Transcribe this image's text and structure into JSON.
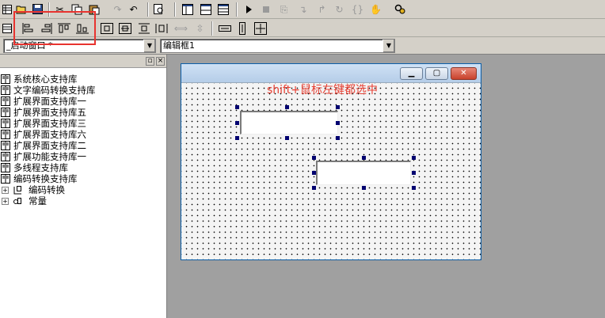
{
  "toolbar_main": {
    "icons": [
      "grid-icon",
      "open-icon",
      "save-icon",
      "cut-icon",
      "copy-icon",
      "paste-icon",
      "redo-icon",
      "undo-icon",
      "find-icon",
      "layout-one-icon",
      "layout-two-icon",
      "layout-three-icon",
      "run-icon",
      "stop-icon",
      "step-icon",
      "step-into-icon",
      "step-out-icon",
      "step-over-icon",
      "brace-icon",
      "hand-icon",
      "debug-icon"
    ]
  },
  "toolbar_align": {
    "icons": [
      "align-left-icon",
      "align-right-icon",
      "align-top-icon",
      "align-bottom-icon",
      "center-horizontal-icon",
      "center-vertical-icon",
      "distribute-horizontal-icon",
      "distribute-vertical-icon",
      "same-width-icon",
      "same-height-icon",
      "same-size-icon",
      "grid-toggle-icon",
      "order-icon",
      "properties-icon"
    ]
  },
  "selectors": {
    "window_combo": "_启动窗口  *",
    "component_combo": "编辑框1"
  },
  "tree": {
    "items": [
      {
        "label": "系统核心支持库"
      },
      {
        "label": "文字编码转换支持库"
      },
      {
        "label": "扩展界面支持库一"
      },
      {
        "label": "扩展界面支持库五"
      },
      {
        "label": "扩展界面支持库三"
      },
      {
        "label": "扩展界面支持库六"
      },
      {
        "label": "扩展界面支持库二"
      },
      {
        "label": "扩展功能支持库一"
      },
      {
        "label": "多线程支持库"
      },
      {
        "label": "编码转换支持库"
      }
    ],
    "expandable": [
      {
        "label": "编码转换"
      },
      {
        "label": "常量"
      }
    ]
  },
  "designer": {
    "note": "shift+鼠标左键都选中",
    "window_buttons": [
      "minimize-icon",
      "maximize-icon",
      "close-icon"
    ]
  },
  "colors": {
    "highlight_box": "#e8332f",
    "note_text": "#e84033",
    "handle": "#000070"
  }
}
